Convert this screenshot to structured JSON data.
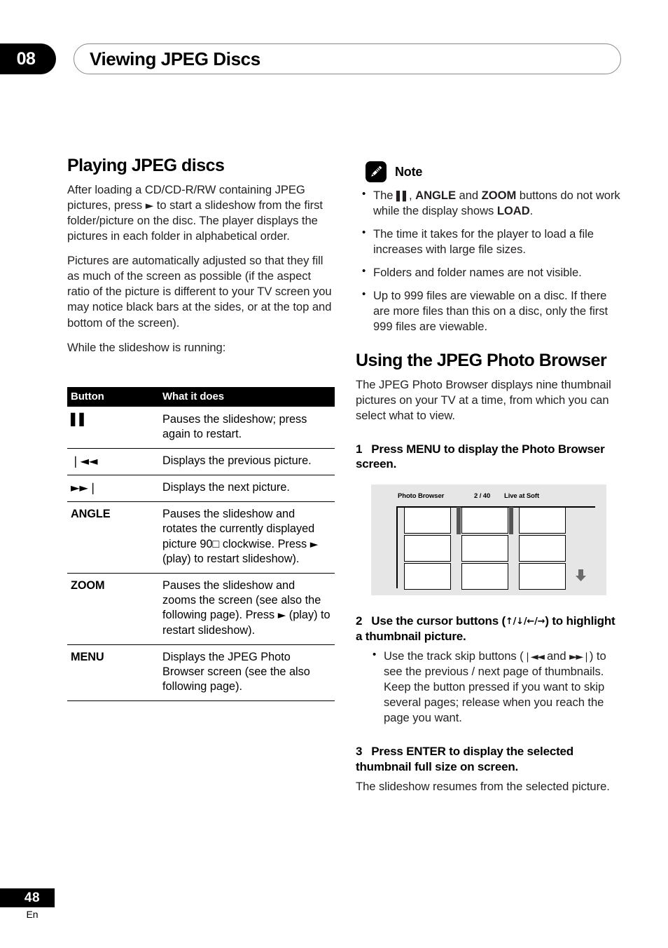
{
  "header": {
    "chapter_number": "08",
    "chapter_title": "Viewing JPEG Discs"
  },
  "left_column": {
    "section_title": "Playing JPEG discs",
    "paragraph_1_before": "After loading a CD/CD-R/RW containing JPEG pictures, press ",
    "play_glyph": "►",
    "paragraph_1_after": " to start a slideshow from the first folder/picture on the disc. The player displays the pictures in each folder in alphabetical order.",
    "paragraph_2": "Pictures are automatically adjusted so that they fill as much of the screen as possible (if the aspect ratio of the picture is different to your TV screen you may notice black bars at the sides, or at the top and bottom of the screen).",
    "paragraph_3": "While the slideshow is running:",
    "table": {
      "headers": [
        "Button",
        "What it does"
      ],
      "rows": [
        {
          "button": "▌▌",
          "button_is_icon": true,
          "icon_name": "pause-icon",
          "description": "Pauses the slideshow; press again to restart."
        },
        {
          "button": "❘◄◄",
          "button_is_icon": true,
          "icon_name": "previous-track-icon",
          "description": "Displays the previous picture."
        },
        {
          "button": "►►❘",
          "button_is_icon": true,
          "icon_name": "next-track-icon",
          "description": "Displays the next picture."
        },
        {
          "button": "ANGLE",
          "button_is_icon": false,
          "icon_name": "angle-button-label",
          "description_part_1": "Pauses the slideshow and rotates the currently displayed picture 90□ clockwise. Press ",
          "description_glyph": "►",
          "description_part_2": " (play) to restart slideshow)."
        },
        {
          "button": "ZOOM",
          "button_is_icon": false,
          "icon_name": "zoom-button-label",
          "description_part_1": "Pauses the slideshow and zooms the screen (see also the following page). Press ",
          "description_glyph": "►",
          "description_part_2": " (play) to restart slideshow)."
        },
        {
          "button": "MENU",
          "button_is_icon": false,
          "icon_name": "menu-button-label",
          "description": "Displays the JPEG Photo Browser screen (see the also following page)."
        }
      ]
    }
  },
  "right_column": {
    "note": {
      "label": "Note",
      "icon_name": "pencil-note-icon",
      "items": [
        {
          "t1": "The ",
          "glyph": "▌▌",
          "t2": ", ",
          "b1": "ANGLE",
          "t3": " and ",
          "b2": "ZOOM",
          "t4": " buttons do not work while the display shows ",
          "b3": "LOAD",
          "t5": "."
        },
        {
          "plain": "The time it takes for the player to load a file increases with large file sizes."
        },
        {
          "plain": "Folders and folder names are not visible."
        },
        {
          "plain": "Up to 999 files are viewable on a disc. If there are more files than this on a disc, only the first 999 files are viewable."
        }
      ]
    },
    "section_title": "Using the JPEG Photo Browser",
    "intro": "The JPEG Photo Browser displays nine thumbnail pictures on your TV at a time, from which you can select what to view.",
    "step1": {
      "number": "1",
      "text": "Press MENU to display the Photo Browser screen."
    },
    "figure": {
      "title": "Photo Browser",
      "count": "2 / 40",
      "name": "Live at Soft",
      "thumbnails": [
        {
          "selected": false
        },
        {
          "selected": true
        },
        {
          "selected": false
        },
        {
          "selected": false
        },
        {
          "selected": false
        },
        {
          "selected": false
        },
        {
          "selected": false
        },
        {
          "selected": false
        },
        {
          "selected": false
        }
      ],
      "scroll_arrow": "down-arrow-icon"
    },
    "step2": {
      "number": "2",
      "text_before": "Use the cursor buttons (",
      "arrows": "↑/↓/←/→",
      "text_after": ") to highlight a thumbnail picture.",
      "bullet": {
        "t1": "Use the track skip buttons (",
        "g1": "❘◄◄",
        "t2": " and ",
        "g2": "►►❘",
        "t3": ") to see the previous / next page of thumbnails. Keep the button pressed if you want to skip several pages; release when you reach the page you want."
      }
    },
    "step3": {
      "number": "3",
      "text": "Press ENTER to display the selected thumbnail full size on screen.",
      "body": "The slideshow resumes from the selected picture."
    }
  },
  "footer": {
    "page_number": "48",
    "language": "En"
  },
  "colors": {
    "ink": "#000000",
    "body_text": "#231f20",
    "figure_background": "#e6e6e6",
    "figure_selection_bar": "#555555",
    "pill_border": "#8a8a8a"
  }
}
